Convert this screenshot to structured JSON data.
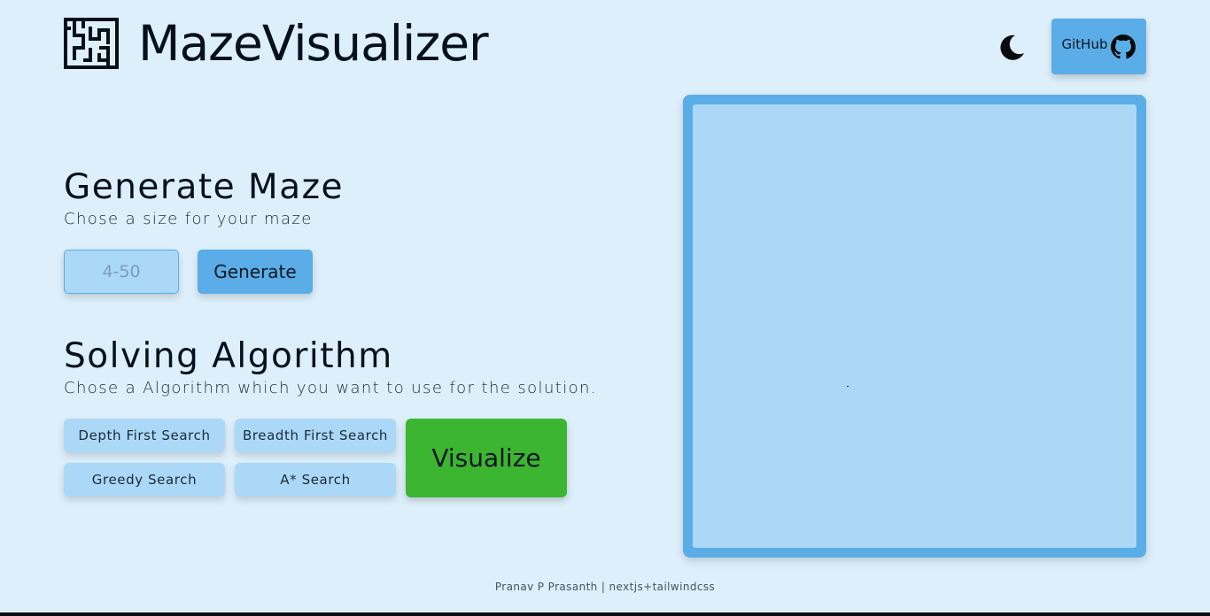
{
  "header": {
    "title": "MazeVisualizer",
    "logo_icon": "maze-logo-icon",
    "theme_icon": "moon-icon",
    "github_label": "GitHub",
    "github_icon": "github-icon"
  },
  "generate": {
    "title": "Generate Maze",
    "subtitle": "Chose a size for your maze",
    "input_placeholder": "4-50",
    "input_value": "",
    "button_label": "Generate"
  },
  "solve": {
    "title": "Solving Algorithm",
    "subtitle": "Chose a Algorithm which you want to use for the solution.",
    "algorithms": [
      {
        "label": "Depth First Search"
      },
      {
        "label": "Breadth First Search"
      },
      {
        "label": "Greedy Search"
      },
      {
        "label": "A* Search"
      }
    ],
    "visualize_label": "Visualize"
  },
  "footer": {
    "text": "Pranav P Prasanth | nextjs+tailwindcss"
  },
  "colors": {
    "background": "#ddeffb",
    "accent": "#5aade6",
    "light_accent": "#abd8f6",
    "visualize_green": "#3cb531",
    "text": "#06111c"
  }
}
